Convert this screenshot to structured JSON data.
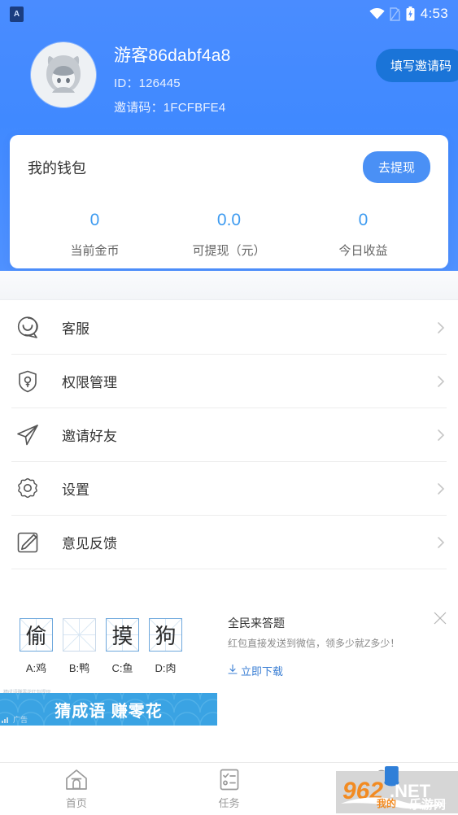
{
  "status_bar": {
    "time": "4:53",
    "app_badge": "A",
    "icons": [
      "wifi-icon",
      "sim-missing-icon",
      "battery-charging-icon"
    ]
  },
  "profile": {
    "name": "游客86dabf4a8",
    "id_label": "ID：126445",
    "invite_code_label": "邀请码：1FCFBFE4",
    "invite_button": "填写邀请码",
    "avatar": "cat-hoodie-avatar"
  },
  "wallet": {
    "title": "我的钱包",
    "withdraw_button": "去提现",
    "stats": [
      {
        "value": "0",
        "label": "当前金币"
      },
      {
        "value": "0.0",
        "label": "可提现（元）"
      },
      {
        "value": "0",
        "label": "今日收益"
      }
    ]
  },
  "menu": {
    "items": [
      {
        "label": "客服",
        "icon": "smiley-chat-icon"
      },
      {
        "label": "权限管理",
        "icon": "shield-key-icon"
      },
      {
        "label": "邀请好友",
        "icon": "paper-plane-icon"
      },
      {
        "label": "设置",
        "icon": "gear-icon"
      },
      {
        "label": "意见反馈",
        "icon": "edit-note-icon"
      }
    ]
  },
  "ad": {
    "title": "全民来答题",
    "description": "红包直接发送到微信，领多少就Z多少！",
    "download_label": "立即下载",
    "close_icon": "close-icon",
    "download_icon": "download-icon",
    "puzzle": {
      "tiles": [
        "偷",
        "",
        "摸",
        "狗"
      ],
      "options": [
        "A:鸡",
        "B:鸭",
        "C:鱼",
        "D:肉"
      ]
    }
  },
  "banner": {
    "text": "猜成语 赚零花",
    "ad_label": "广告",
    "top_note": "猜成语赚零花红包提现"
  },
  "tabbar": {
    "items": [
      {
        "label": "首页",
        "icon": "home-icon"
      },
      {
        "label": "任务",
        "icon": "task-list-icon"
      },
      {
        "label": "我的",
        "icon": "user-icon"
      }
    ]
  },
  "watermark": {
    "text": "962.NET 乐游网"
  },
  "colors": {
    "header_blue": "#4a8cff",
    "accent_blue": "#4a90f5",
    "invite_button": "#1a74d8",
    "stat_value": "#3e9bf0",
    "banner_blue": "#3aa3e3",
    "link_blue": "#3b7fd4"
  }
}
